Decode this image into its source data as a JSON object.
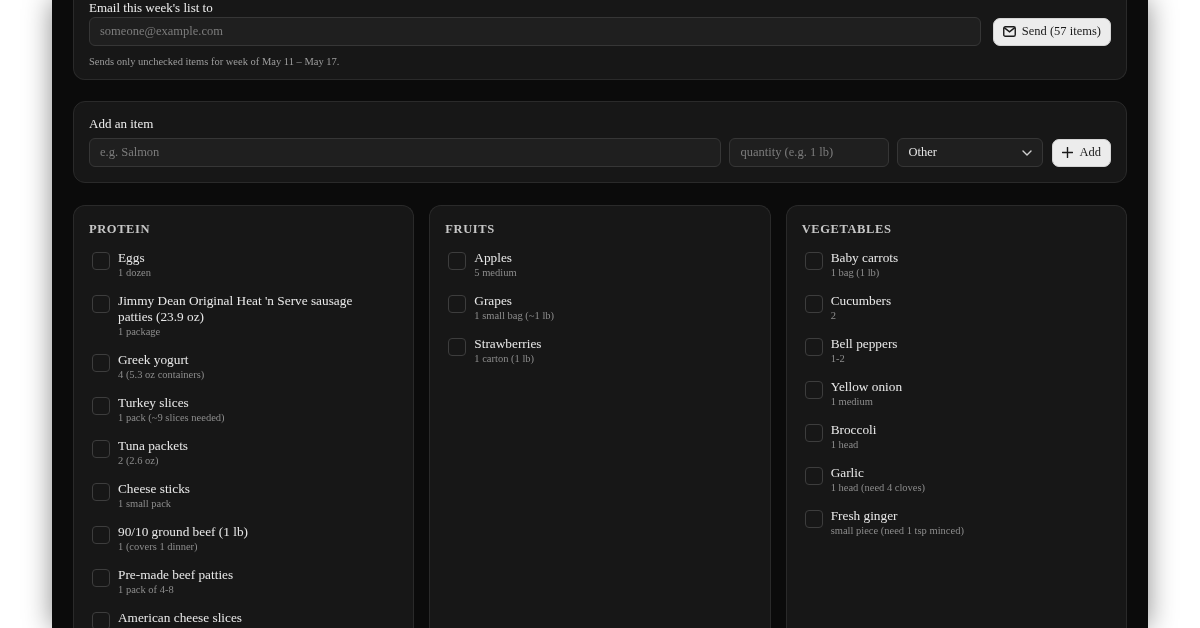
{
  "email": {
    "label": "Email this week's list to",
    "placeholder": "someone@example.com",
    "send_button": "Send (57 items)",
    "hint": "Sends only unchecked items for week of May 11 – May 17."
  },
  "add_item": {
    "label": "Add an item",
    "name_placeholder": "e.g. Salmon",
    "quantity_placeholder": "quantity (e.g. 1 lb)",
    "category": "Other",
    "add_button": "Add"
  },
  "categories": [
    {
      "title": "PROTEIN",
      "items": [
        {
          "name": "Eggs",
          "quantity": "1 dozen",
          "checked": false
        },
        {
          "name": "Jimmy Dean Original Heat 'n Serve sausage patties (23.9 oz)",
          "quantity": "1 package",
          "checked": false
        },
        {
          "name": "Greek yogurt",
          "quantity": "4 (5.3 oz containers)",
          "checked": false
        },
        {
          "name": "Turkey slices",
          "quantity": "1 pack (~9 slices needed)",
          "checked": false
        },
        {
          "name": "Tuna packets",
          "quantity": "2 (2.6 oz)",
          "checked": false
        },
        {
          "name": "Cheese sticks",
          "quantity": "1 small pack",
          "checked": false
        },
        {
          "name": "90/10 ground beef (1 lb)",
          "quantity": "1 (covers 1 dinner)",
          "checked": false
        },
        {
          "name": "Pre-made beef patties",
          "quantity": "1 pack of 4-8",
          "checked": false
        },
        {
          "name": "American cheese slices",
          "checked": false
        }
      ]
    },
    {
      "title": "FRUITS",
      "items": [
        {
          "name": "Apples",
          "quantity": "5 medium",
          "checked": false
        },
        {
          "name": "Grapes",
          "quantity": "1 small bag (~1 lb)",
          "checked": false
        },
        {
          "name": "Strawberries",
          "quantity": "1 carton (1 lb)",
          "checked": false
        }
      ]
    },
    {
      "title": "VEGETABLES",
      "items": [
        {
          "name": "Baby carrots",
          "quantity": "1 bag (1 lb)",
          "checked": false
        },
        {
          "name": "Cucumbers",
          "quantity": "2",
          "checked": false
        },
        {
          "name": "Bell peppers",
          "quantity": "1-2",
          "checked": false
        },
        {
          "name": "Yellow onion",
          "quantity": "1 medium",
          "checked": false
        },
        {
          "name": "Broccoli",
          "quantity": "1 head",
          "checked": false
        },
        {
          "name": "Garlic",
          "quantity": "1 head (need 4 cloves)",
          "checked": false
        },
        {
          "name": "Fresh ginger",
          "quantity": "small piece (need 1 tsp minced)",
          "checked": false
        }
      ]
    }
  ]
}
